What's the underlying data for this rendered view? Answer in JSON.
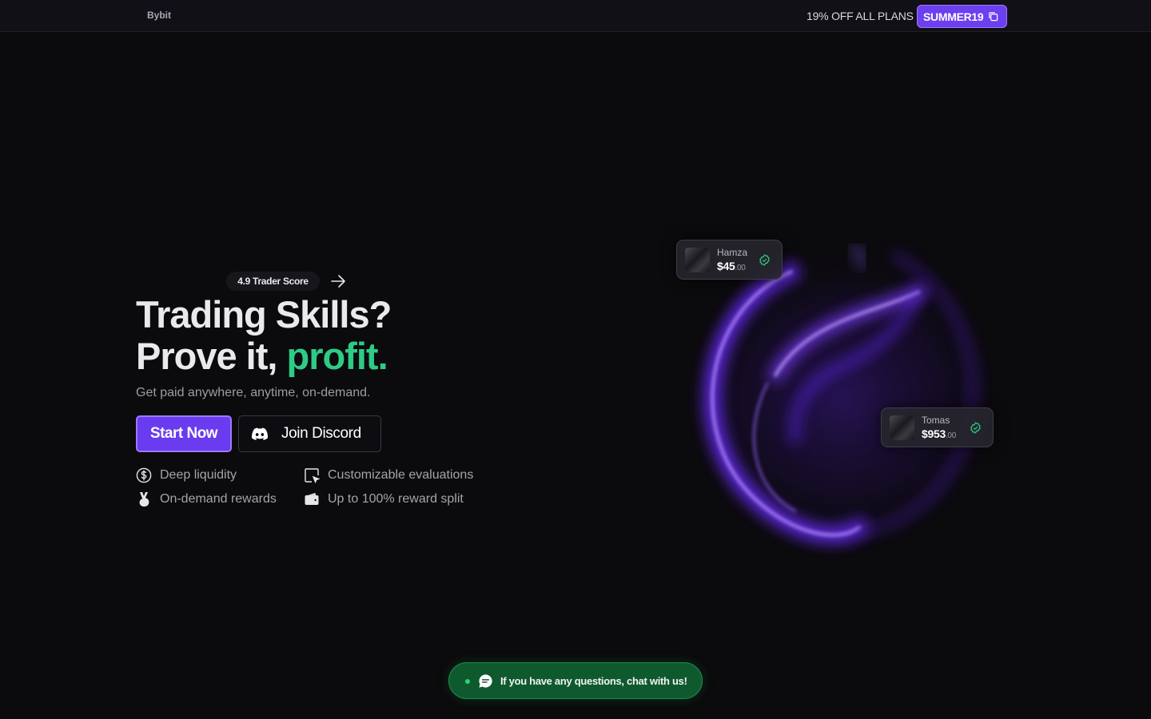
{
  "header": {
    "brand": "Bybit",
    "promo_text": "19% OFF ALL PLANS",
    "coupon_code": "SUMMER19"
  },
  "hero": {
    "score_badge": "4.9 Trader Score",
    "headline_line1": "Trading Skills?",
    "headline_line2_prefix": "Prove it, ",
    "headline_line2_accent": "profit.",
    "subline": "Get paid anywhere, anytime, on-demand.",
    "start_button": "Start Now",
    "discord_button": "Join Discord",
    "features": [
      {
        "label": "Deep liquidity",
        "icon": "dollar-circle-icon"
      },
      {
        "label": "Customizable evaluations",
        "icon": "square-cursor-icon"
      },
      {
        "label": "On-demand rewards",
        "icon": "medal-icon"
      },
      {
        "label": "Up to 100% reward split",
        "icon": "wallet-icon"
      }
    ]
  },
  "payout_cards": [
    {
      "name": "Hamza",
      "amount": "$45",
      "cents": ".00"
    },
    {
      "name": "Tomas",
      "amount": "$953",
      "cents": ".00"
    }
  ],
  "chat": {
    "label": "If you have any questions, chat with us!"
  },
  "colors": {
    "accent_purple": "#6a3bef",
    "accent_green": "#2ecb86",
    "background": "#0b0a0c",
    "chat_green": "#0e5a2e"
  }
}
